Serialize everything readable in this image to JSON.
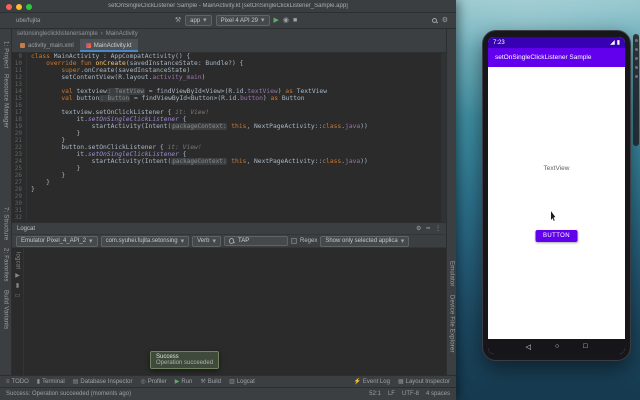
{
  "icons": {
    "hammer": "⚒",
    "caret": "▾",
    "run": "▶",
    "debug": "◉",
    "stop": "■",
    "gear": "⚙",
    "minimize": "━",
    "kebab": "⋮",
    "todo": "≡",
    "terminal": "▮",
    "database": "▤",
    "profiler": "◎",
    "build": "⚒",
    "logcat": "▥",
    "event_log": "⚡",
    "layout_inspector": "▦",
    "crumb_sep": "›",
    "phone_signal": "◢",
    "phone_battery": "▮",
    "nav_back": "◁",
    "nav_home": "○",
    "nav_recents": "□",
    "rail_play": "▶",
    "rail_pause": "▮▮",
    "rail_trash": "▭"
  },
  "titlebar": {
    "title": "setOnSingleClickListener Sample - MainActivity.kt [setOnSingleClickListener_Sample.app]"
  },
  "toolbar": {
    "path": "ube/fujita",
    "app": "app",
    "device": "Pixel 4 API 29"
  },
  "navbar": {
    "module": "setonsingleclicklistenersample",
    "item": "MainActivity"
  },
  "tabs": {
    "xml": "activity_main.xml",
    "kt": "MainActivity.kt"
  },
  "stripes": {
    "left": [
      "1: Project",
      "Resource Manager",
      "7: Structure",
      "2: Favorites",
      "Build Variants"
    ],
    "right": [
      "Emulator",
      "Device File Explorer"
    ]
  },
  "editor": {
    "lines": [
      {
        "n": 9,
        "s": [
          [
            "k",
            "class "
          ],
          [
            "p",
            "MainActivity : AppCompatActivity() {"
          ]
        ]
      },
      {
        "n": 10,
        "s": [
          [
            "p",
            "    "
          ],
          [
            "k",
            "override fun "
          ],
          [
            "f",
            "onCreate"
          ],
          [
            "p",
            "(savedInstanceState: Bundle?) {"
          ]
        ]
      },
      {
        "n": 11,
        "s": [
          [
            "p",
            "        "
          ],
          [
            "k",
            "super"
          ],
          [
            "p",
            ".onCreate(savedInstanceState)"
          ]
        ]
      },
      {
        "n": 12,
        "s": [
          [
            "p",
            "        setContentView(R.layout."
          ],
          [
            "r",
            "activity_main"
          ],
          [
            "p",
            ")"
          ]
        ]
      },
      {
        "n": 13,
        "s": []
      },
      {
        "n": 14,
        "s": [
          [
            "p",
            "        "
          ],
          [
            "k",
            "val "
          ],
          [
            "p",
            "textview"
          ],
          [
            "h",
            ": TextView"
          ],
          [
            "p",
            " = findViewById<View>(R.id."
          ],
          [
            "r",
            "textView"
          ],
          [
            "p",
            ") "
          ],
          [
            "k",
            "as"
          ],
          [
            "p",
            " TextView"
          ]
        ]
      },
      {
        "n": 15,
        "s": [
          [
            "p",
            "        "
          ],
          [
            "k",
            "val "
          ],
          [
            "p",
            "button"
          ],
          [
            "h",
            ": Button"
          ],
          [
            "p",
            " = findViewById<Button>(R.id."
          ],
          [
            "r",
            "button"
          ],
          [
            "p",
            ") "
          ],
          [
            "k",
            "as"
          ],
          [
            "p",
            " Button"
          ]
        ]
      },
      {
        "n": 16,
        "s": []
      },
      {
        "n": 17,
        "s": [
          [
            "p",
            "        textview.setOnClickListener { "
          ],
          [
            "hi",
            "it: View!"
          ]
        ]
      },
      {
        "n": 18,
        "s": [
          [
            "p",
            "            it."
          ],
          [
            "x",
            "setOnSingleClickListener"
          ],
          [
            "p",
            " {"
          ]
        ]
      },
      {
        "n": 19,
        "s": [
          [
            "p",
            "                startActivity(Intent("
          ],
          [
            "h",
            "packageContext:"
          ],
          [
            "p",
            " "
          ],
          [
            "k",
            "this"
          ],
          [
            "p",
            ", NextPageActivity::"
          ],
          [
            "k",
            "class"
          ],
          [
            "p",
            "."
          ],
          [
            "r",
            "java"
          ],
          [
            "p",
            "))"
          ]
        ]
      },
      {
        "n": 20,
        "s": [
          [
            "p",
            "            }"
          ]
        ]
      },
      {
        "n": 21,
        "s": [
          [
            "p",
            "        }"
          ]
        ]
      },
      {
        "n": 22,
        "s": [
          [
            "p",
            "        button.setOnClickListener { "
          ],
          [
            "hi",
            "it: View!"
          ]
        ]
      },
      {
        "n": 23,
        "s": [
          [
            "p",
            "            it."
          ],
          [
            "x",
            "setOnSingleClickListener"
          ],
          [
            "p",
            " {"
          ]
        ]
      },
      {
        "n": 24,
        "s": [
          [
            "p",
            "                startActivity(Intent("
          ],
          [
            "h",
            "packageContext:"
          ],
          [
            "p",
            " "
          ],
          [
            "k",
            "this"
          ],
          [
            "p",
            ", NextPageActivity::"
          ],
          [
            "k",
            "class"
          ],
          [
            "p",
            "."
          ],
          [
            "r",
            "java"
          ],
          [
            "p",
            "))"
          ]
        ]
      },
      {
        "n": 25,
        "s": [
          [
            "p",
            "            }"
          ]
        ]
      },
      {
        "n": 26,
        "s": [
          [
            "p",
            "        }"
          ]
        ]
      },
      {
        "n": 27,
        "s": [
          [
            "p",
            "    }"
          ]
        ]
      },
      {
        "n": 28,
        "s": [
          [
            "p",
            "}"
          ]
        ]
      },
      {
        "n": 29,
        "s": []
      },
      {
        "n": 30,
        "s": []
      },
      {
        "n": 31,
        "s": []
      },
      {
        "n": 32,
        "s": []
      }
    ]
  },
  "logcat": {
    "title": "Logcat",
    "rail_label": "logcat",
    "device": "Emulator Pixel_4_API_2",
    "process": "com.syuhei.fujita.setonsing",
    "level": "Verb",
    "search": "TAP",
    "regex": "Regex",
    "filter": "Show only selected applica"
  },
  "tooltip": {
    "title": "Success",
    "body": "Operation succeeded"
  },
  "toolbuttons": {
    "left": [
      "TODO",
      "Terminal",
      "Database Inspector",
      "Profiler",
      "Run",
      "Build",
      "Logcat"
    ],
    "right": [
      "Event Log",
      "Layout Inspector"
    ]
  },
  "statusbar": {
    "message": "Success: Operation succeeded (moments ago)",
    "caret_pos": "52:1",
    "line_sep": "LF",
    "encoding": "UTF-8",
    "indent": "4 spaces"
  },
  "phone": {
    "time": "7:23",
    "appbar": "setOnSingleClickListener Sample",
    "textview": "TextView",
    "button": "BUTTON"
  },
  "colors": {
    "android_appbar": "#6200ee",
    "android_statusbar": "#3700b3",
    "ide_accent": "#4a88c7",
    "run_green": "#5fad65"
  }
}
